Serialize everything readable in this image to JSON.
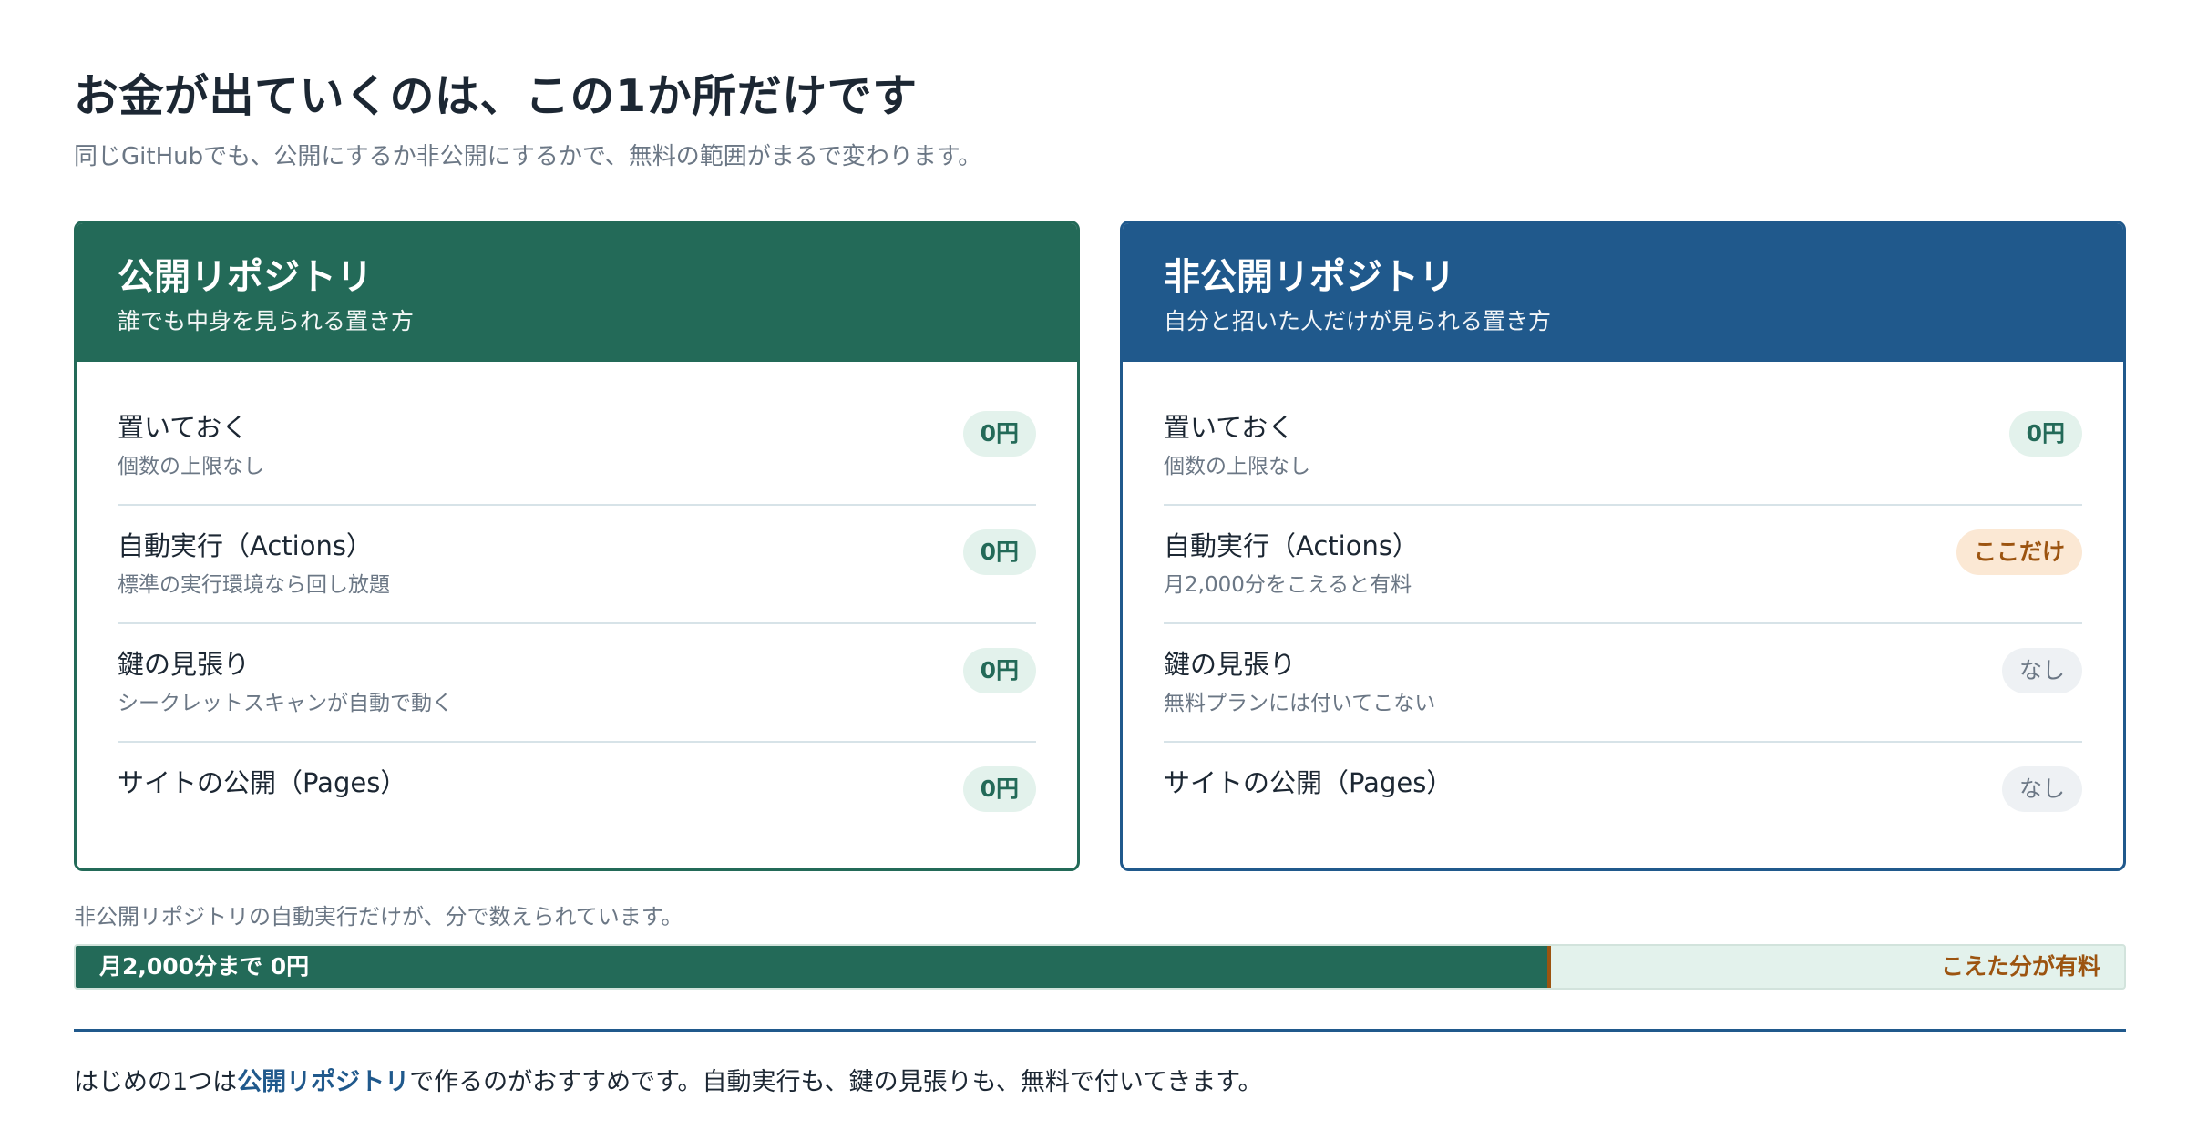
{
  "page": {
    "title": "お金が出ていくのは、この1か所だけです",
    "subtitle": "同じGitHubでも、公開にするか非公開にするかで、無料の範囲がまるで変わります。"
  },
  "colors": {
    "public_accent": "#236a58",
    "private_accent": "#20598c",
    "paid_accent": "#9c5410",
    "free_pill_bg": "#e3f2ec",
    "paid_pill_bg": "#fbe8d4",
    "none_pill_bg": "#eef1f4"
  },
  "public_card": {
    "title": "公開リポジトリ",
    "subtitle": "誰でも中身を見られる置き方",
    "rows": [
      {
        "label": "置いておく",
        "note": "個数の上限なし",
        "badge": "0円",
        "badge_type": "free"
      },
      {
        "label": "自動実行（Actions）",
        "note": "標準の実行環境なら回し放題",
        "badge": "0円",
        "badge_type": "free"
      },
      {
        "label": "鍵の見張り",
        "note": "シークレットスキャンが自動で動く",
        "badge": "0円",
        "badge_type": "free"
      },
      {
        "label": "サイトの公開（Pages）",
        "note": "",
        "badge": "0円",
        "badge_type": "free"
      }
    ]
  },
  "private_card": {
    "title": "非公開リポジトリ",
    "subtitle": "自分と招いた人だけが見られる置き方",
    "rows": [
      {
        "label": "置いておく",
        "note": "個数の上限なし",
        "badge": "0円",
        "badge_type": "free"
      },
      {
        "label": "自動実行（Actions）",
        "note": "月2,000分をこえると有料",
        "badge": "ここだけ",
        "badge_type": "paid"
      },
      {
        "label": "鍵の見張り",
        "note": "無料プランには付いてこない",
        "badge": "なし",
        "badge_type": "none"
      },
      {
        "label": "サイトの公開（Pages）",
        "note": "",
        "badge": "なし",
        "badge_type": "none"
      }
    ]
  },
  "meter": {
    "caption": "非公開リポジトリの自動実行だけが、分で数えられています。",
    "free_label": "月2,000分まで 0円",
    "paid_label": "こえた分が有料",
    "free_fraction": 0.72
  },
  "footer": {
    "before": "はじめの1つは",
    "highlight": "公開リポジトリ",
    "after": "で作るのがおすすめです。自動実行も、鍵の見張りも、無料で付いてきます。"
  }
}
